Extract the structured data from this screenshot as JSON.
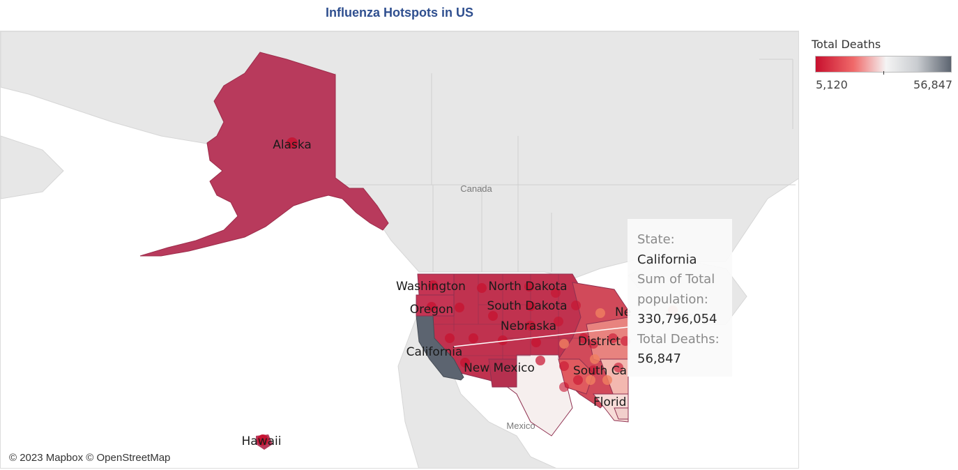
{
  "title": "Influenza Hotspots in US",
  "attribution": "© 2023 Mapbox © OpenStreetMap",
  "colors": {
    "title": "#2f4f8f",
    "high": "#5c6470",
    "low": "#c8102e",
    "mid": "#f4f4f4"
  },
  "map_labels": {
    "alaska": "Alaska",
    "hawaii": "Hawaii",
    "washington": "Washington",
    "oregon": "Oregon",
    "california": "California",
    "north_dakota": "North Dakota",
    "south_dakota": "South Dakota",
    "nebraska": "Nebraska",
    "new_mexico": "New Mexico",
    "district": "District",
    "south_carolina": "South Ca",
    "florida": "Florid",
    "new_york_partial": "Ne",
    "canada": "Canada",
    "mexico": "Mexico"
  },
  "tooltip": {
    "state_label": "State:",
    "state_value": "California",
    "population_label_1": "Sum of Total",
    "population_label_2": "population:",
    "population_value": "330,796,054",
    "deaths_label": "Total Deaths:",
    "deaths_value": "56,847"
  },
  "legend": {
    "title": "Total Deaths",
    "min": "5,120",
    "max": "56,847"
  }
}
